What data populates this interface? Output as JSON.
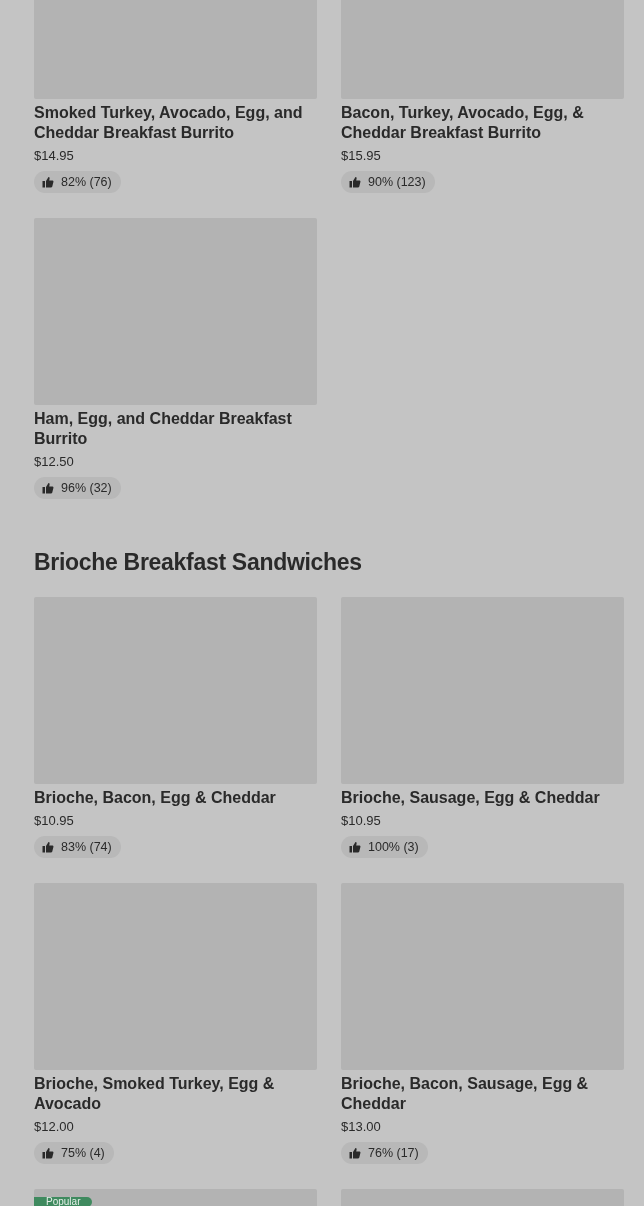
{
  "sections": [
    {
      "items": [
        {
          "title": "Smoked Turkey, Avocado, Egg, and Cheddar Breakfast Burrito",
          "price": "$14.95",
          "rating": "82% (76)"
        },
        {
          "title": "Bacon, Turkey, Avocado, Egg, & Cheddar Breakfast Burrito",
          "price": "$15.95",
          "rating": "90% (123)"
        },
        {
          "title": "Ham, Egg, and Cheddar Breakfast Burrito",
          "price": "$12.50",
          "rating": "96% (32)"
        }
      ]
    },
    {
      "title": "Brioche Breakfast Sandwiches",
      "items": [
        {
          "title": "Brioche, Bacon, Egg & Cheddar",
          "price": "$10.95",
          "rating": "83% (74)"
        },
        {
          "title": "Brioche, Sausage, Egg & Cheddar",
          "price": "$10.95",
          "rating": "100% (3)"
        },
        {
          "title": "Brioche, Smoked Turkey, Egg & Avocado",
          "price": "$12.00",
          "rating": "75% (4)"
        },
        {
          "title": "Brioche, Bacon, Sausage, Egg & Cheddar",
          "price": "$13.00",
          "rating": "76% (17)"
        },
        {
          "badge": "Popular"
        }
      ],
      "continues": true
    }
  ]
}
